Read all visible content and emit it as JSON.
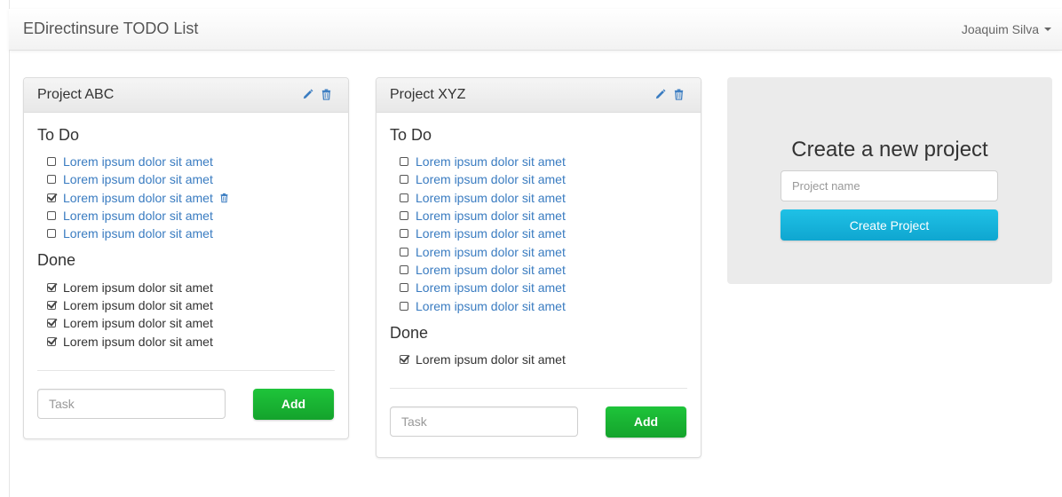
{
  "navbar": {
    "brand": "EDirectinsure TODO List",
    "user": "Joaquim Silva"
  },
  "projects": [
    {
      "title": "Project ABC",
      "todo_heading": "To Do",
      "done_heading": "Done",
      "todo": [
        {
          "label": "Lorem ipsum dolor sit amet",
          "checked": false
        },
        {
          "label": "Lorem ipsum dolor sit amet",
          "checked": false
        },
        {
          "label": "Lorem ipsum dolor sit amet",
          "checked": true,
          "hover_delete": true
        },
        {
          "label": "Lorem ipsum dolor sit amet",
          "checked": false
        },
        {
          "label": "Lorem ipsum dolor sit amet",
          "checked": false
        }
      ],
      "done": [
        {
          "label": "Lorem ipsum dolor sit amet",
          "checked": true
        },
        {
          "label": "Lorem ipsum dolor sit amet",
          "checked": true
        },
        {
          "label": "Lorem ipsum dolor sit amet",
          "checked": true
        },
        {
          "label": "Lorem ipsum dolor sit amet",
          "checked": true
        }
      ],
      "task_placeholder": "Task",
      "add_label": "Add"
    },
    {
      "title": "Project XYZ",
      "todo_heading": "To Do",
      "done_heading": "Done",
      "todo": [
        {
          "label": "Lorem ipsum dolor sit amet",
          "checked": false
        },
        {
          "label": "Lorem ipsum dolor sit amet",
          "checked": false
        },
        {
          "label": "Lorem ipsum dolor sit amet",
          "checked": false
        },
        {
          "label": "Lorem ipsum dolor sit amet",
          "checked": false
        },
        {
          "label": "Lorem ipsum dolor sit amet",
          "checked": false
        },
        {
          "label": "Lorem ipsum dolor sit amet",
          "checked": false
        },
        {
          "label": "Lorem ipsum dolor sit amet",
          "checked": false
        },
        {
          "label": "Lorem ipsum dolor sit amet",
          "checked": false
        },
        {
          "label": "Lorem ipsum dolor sit amet",
          "checked": false
        }
      ],
      "done": [
        {
          "label": "Lorem ipsum dolor sit amet",
          "checked": true
        }
      ],
      "task_placeholder": "Task",
      "add_label": "Add"
    }
  ],
  "create_project": {
    "title": "Create a new project",
    "placeholder": "Project name",
    "button_label": "Create Project"
  },
  "colors": {
    "link": "#3a7cc1",
    "add_button": "#18b233",
    "create_button": "#17b4dc",
    "jumbotron_bg": "#ebebeb"
  }
}
